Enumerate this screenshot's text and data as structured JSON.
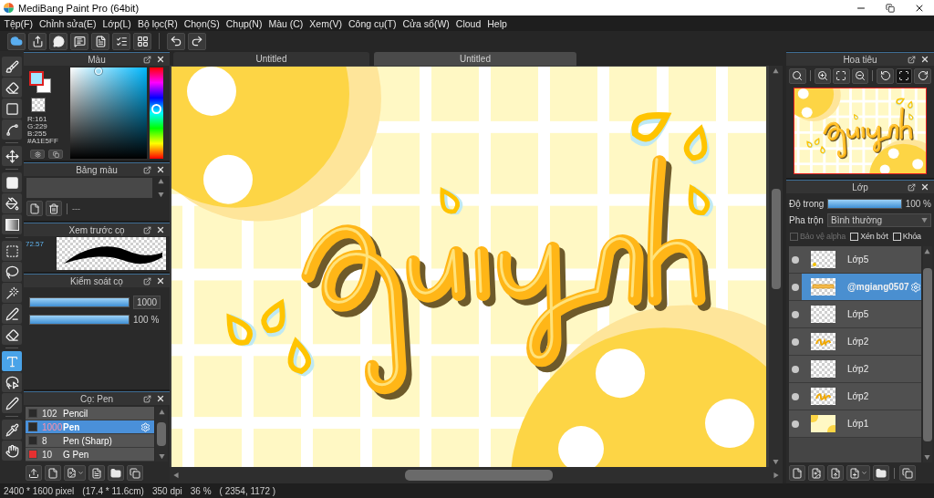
{
  "window": {
    "title": "MediBang Paint Pro (64bit)"
  },
  "menu": [
    "Tệp(F)",
    "Chỉnh sửa(E)",
    "Lớp(L)",
    "Bộ lọc(R)",
    "Chọn(S)",
    "Chụp(N)",
    "Màu (C)",
    "Xem(V)",
    "Công cụ(T)",
    "Cửa sổ(W)",
    "Cloud",
    "Help"
  ],
  "tool_groups": [
    [
      {
        "kind": "brush",
        "selected": false
      },
      {
        "kind": "eraser",
        "selected": false
      },
      {
        "kind": "shape",
        "selected": false
      },
      {
        "kind": "polyline",
        "selected": false
      }
    ],
    [
      {
        "kind": "move",
        "selected": false
      }
    ],
    [
      {
        "kind": "fill",
        "selected": false
      },
      {
        "kind": "bucket",
        "selected": false
      },
      {
        "kind": "gradient",
        "selected": false
      }
    ],
    [
      {
        "kind": "select",
        "selected": false
      },
      {
        "kind": "lasso",
        "selected": false
      },
      {
        "kind": "wand",
        "selected": false
      },
      {
        "kind": "select_pen",
        "selected": false
      },
      {
        "kind": "select_eraser",
        "selected": false
      }
    ],
    [
      {
        "kind": "text",
        "selected": true
      },
      {
        "kind": "auto_select",
        "selected": false
      },
      {
        "kind": "pen",
        "selected": false
      }
    ],
    [
      {
        "kind": "eyedropper",
        "selected": false
      },
      {
        "kind": "hand",
        "selected": false
      }
    ]
  ],
  "color_panel": {
    "title": "Màu",
    "readout": [
      "R:161",
      "G:229",
      "B:255",
      "#A1E5FF"
    ]
  },
  "palette_panel": {
    "title": "Bảng màu",
    "label": "---"
  },
  "brush_preview_panel": {
    "title": "Xem trước cọ",
    "scale": "72.57"
  },
  "brush_control_panel": {
    "title": "Kiểm soát cọ",
    "sliders": [
      {
        "kind": "field",
        "level": 1,
        "value": "1000"
      },
      {
        "kind": "text",
        "level": 1,
        "value": "100 %"
      }
    ]
  },
  "brush_panel": {
    "title": "Cọ: Pen",
    "brushes": [
      {
        "size": "102",
        "name": "Pencil",
        "color": "#2a2a2a",
        "selected": false
      },
      {
        "size": "1000",
        "name": "Pen",
        "color": "#2a2a2a",
        "selected": true
      },
      {
        "size": "8",
        "name": "Pen (Sharp)",
        "color": "#2a2a2a",
        "selected": false
      },
      {
        "size": "10",
        "name": "G Pen",
        "color": "#e53030",
        "selected": false
      }
    ]
  },
  "canvas": {
    "tabs": [
      {
        "label": "Untitled",
        "selected": false
      },
      {
        "label": "Untitled",
        "selected": true
      }
    ]
  },
  "navigator_panel": {
    "title": "Hoa tiêu"
  },
  "layer_panel": {
    "title": "Lớp",
    "opacity": {
      "label": "Độ trong",
      "level": 1,
      "value": "100 %"
    },
    "blend": {
      "label": "Pha trộn",
      "value": "Bình thường"
    },
    "options": [
      {
        "label": "Bảo vệ alpha",
        "checked": false,
        "disabled": true
      },
      {
        "label": "Xén bớt",
        "checked": false,
        "disabled": false
      },
      {
        "label": "Khóa",
        "checked": false,
        "disabled": false
      }
    ],
    "layers": [
      {
        "name": "Lớp5",
        "kind": "sparse",
        "selected": false
      },
      {
        "name": "@mgiang0507",
        "kind": "text",
        "selected": true
      },
      {
        "name": "Lớp5",
        "kind": "empty",
        "selected": false
      },
      {
        "name": "Lớp2",
        "kind": "lettering",
        "selected": false
      },
      {
        "name": "Lớp2",
        "kind": "empty",
        "selected": false
      },
      {
        "name": "Lớp2",
        "kind": "lettering",
        "selected": false
      },
      {
        "name": "Lớp1",
        "kind": "background",
        "selected": false
      }
    ]
  },
  "status_bar": [
    "2400 * 1600 pixel",
    "(17.4 * 11.6cm)",
    "350 dpi",
    "36 %",
    "( 2354, 1172 )"
  ]
}
